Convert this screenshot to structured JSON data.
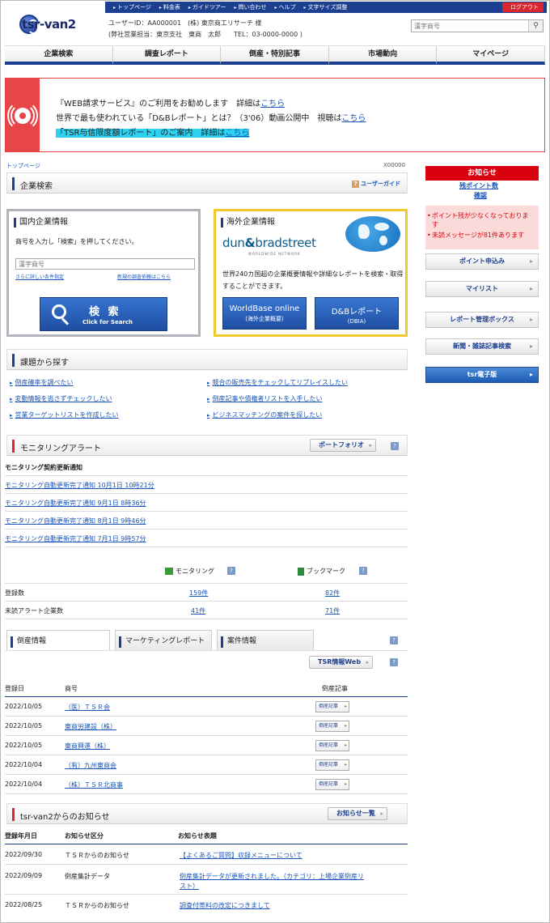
{
  "header": {
    "logo_text": "tsr-van2",
    "nav_links": [
      "トップページ",
      "料金表",
      "ガイドツアー",
      "問い合わせ",
      "ヘルプ",
      "文字サイズ調整"
    ],
    "logout_label": "ログアウト",
    "user_line1": "ユーザーID：AA000001　(株) 東京商工リサーチ 様",
    "user_line2": "(弊社営業担当：東京支社　東商　太郎　　TEL：03-0000-0000 )",
    "search_placeholder": "漢字商号",
    "search_icon": "magnifier-icon"
  },
  "main_nav": [
    "企業検索",
    "調査レポート",
    "倒産・特別記事",
    "市場動向",
    "マイページ"
  ],
  "banner": {
    "line1_text": "『WEB請求サービス』のご利用をお勧めします　詳細は",
    "line1_link": "こちら",
    "line2_text": "世界で最も使われている「D&Bレポート」とは？（3'06）動画公開中　視聴は",
    "line2_link": "こちら",
    "line3_text": "「TSR与信限度額レポート」のご案内　詳細は",
    "line3_link": "こちら"
  },
  "breadcrumb": "トップページ",
  "page_code": "X00000",
  "company_search": {
    "title": "企業検索",
    "guide_label": "ユーザーガイド",
    "domestic": {
      "title": "国内企業情報",
      "desc": "商号を入力し「検索」を押してください。",
      "placeholder": "漢字商号",
      "link1": "さらに詳しい条件指定",
      "link2": "新規の調査依頼はこちら",
      "btn_main": "検 索",
      "btn_sub": "Click for Search"
    },
    "overseas": {
      "title": "海外企業情報",
      "brand_left": "dun",
      "brand_amp": "&",
      "brand_right": "bradstreet",
      "brand_sub": "WORLDWIDE NETWORK",
      "desc": "世界240カ国超の企業概要情報や詳細なレポートを検索・取得することができます。",
      "btn1_main": "WorldBase online",
      "btn1_sub": "(海外企業概要)",
      "btn2_main": "D&Bレポート",
      "btn2_sub": "(DBIA)"
    }
  },
  "topics": {
    "title": "課題から探す",
    "items": [
      "倒産確率を調べたい",
      "競合の販売先をチェックしてリプレイスしたい",
      "変動情報を逃さずチェックしたい",
      "倒産記事や債権者リストを入手したい",
      "営業ターゲットリストを作成したい",
      "ビジネスマッチングの案件を探したい"
    ]
  },
  "monitoring": {
    "title": "モニタリングアラート",
    "portfolio_btn": "ポートフォリオ",
    "help_icon": "?",
    "subtitle": "モニタリング契約更新通知",
    "notices": [
      "モニタリング自動更新完了通知 10月1日 10時21分",
      "モニタリング自動更新完了通知 9月1日 8時36分",
      "モニタリング自動更新完了通知 8月1日 9時46分",
      "モニタリング自動更新完了通知 7月1日 9時57分"
    ],
    "col_monitoring": "モニタリング",
    "col_bookmark": "ブックマーク",
    "row1_label": "登録数",
    "row1_mon": "159件",
    "row1_book": "82件",
    "row2_label": "未読アラート企業数",
    "row2_mon": "41件",
    "row2_book": "71件"
  },
  "info_tabs": {
    "tabs": [
      "倒産情報",
      "マーケティングレポート",
      "案件情報"
    ],
    "tsr_web_btn": "TSR情報Web",
    "col_date": "登録日",
    "col_name": "商号",
    "col_article": "倒産記事",
    "article_btn": "倒産記事",
    "rows": [
      {
        "date": "2022/10/05",
        "name": "（医）ＴＳＲ会"
      },
      {
        "date": "2022/10/05",
        "name": "東商労建設（株）"
      },
      {
        "date": "2022/10/05",
        "name": "東商興運（株）"
      },
      {
        "date": "2022/10/04",
        "name": "（有）九州東商会"
      },
      {
        "date": "2022/10/04",
        "name": "（株）ＴＳＲ北商事"
      }
    ]
  },
  "news": {
    "title": "tsr-van2からのお知らせ",
    "list_btn": "お知らせ一覧",
    "col_date": "登録年月日",
    "col_cat": "お知らせ区分",
    "col_title": "お知らせ表題",
    "rows": [
      {
        "date": "2022/09/30",
        "cat": "ＴＳＲからのお知らせ",
        "title": "【よくあるご質問】収録メニューについて"
      },
      {
        "date": "2022/09/09",
        "cat": "倒産集計データ",
        "title1": "倒産集計データが更新されました。（カテゴリ：上場企業倒産リ",
        "title2": "スト）"
      },
      {
        "date": "2022/08/25",
        "cat": "ＴＳＲからのお知らせ",
        "title": "調査付帯料の改定につきまして"
      }
    ]
  },
  "sidebar": {
    "notice_head": "お知らせ",
    "points_label": "残ポイント数",
    "confirm_link": "確認",
    "alert1": "ポイント残が少なくなっております",
    "alert2": "未読メッセージが81件あります",
    "buttons": [
      "ポイント申込み",
      "マイリスト",
      "レポート管理ボックス",
      "新聞・雑誌記事検索",
      "tsr電子版"
    ]
  },
  "colors": {
    "brand_navy": "#1d3f8f",
    "accent_red": "#d9262f",
    "link_blue": "#1a56b8",
    "highlight_cyan": "#2ed2f0",
    "overseas_border": "#f2c830"
  }
}
